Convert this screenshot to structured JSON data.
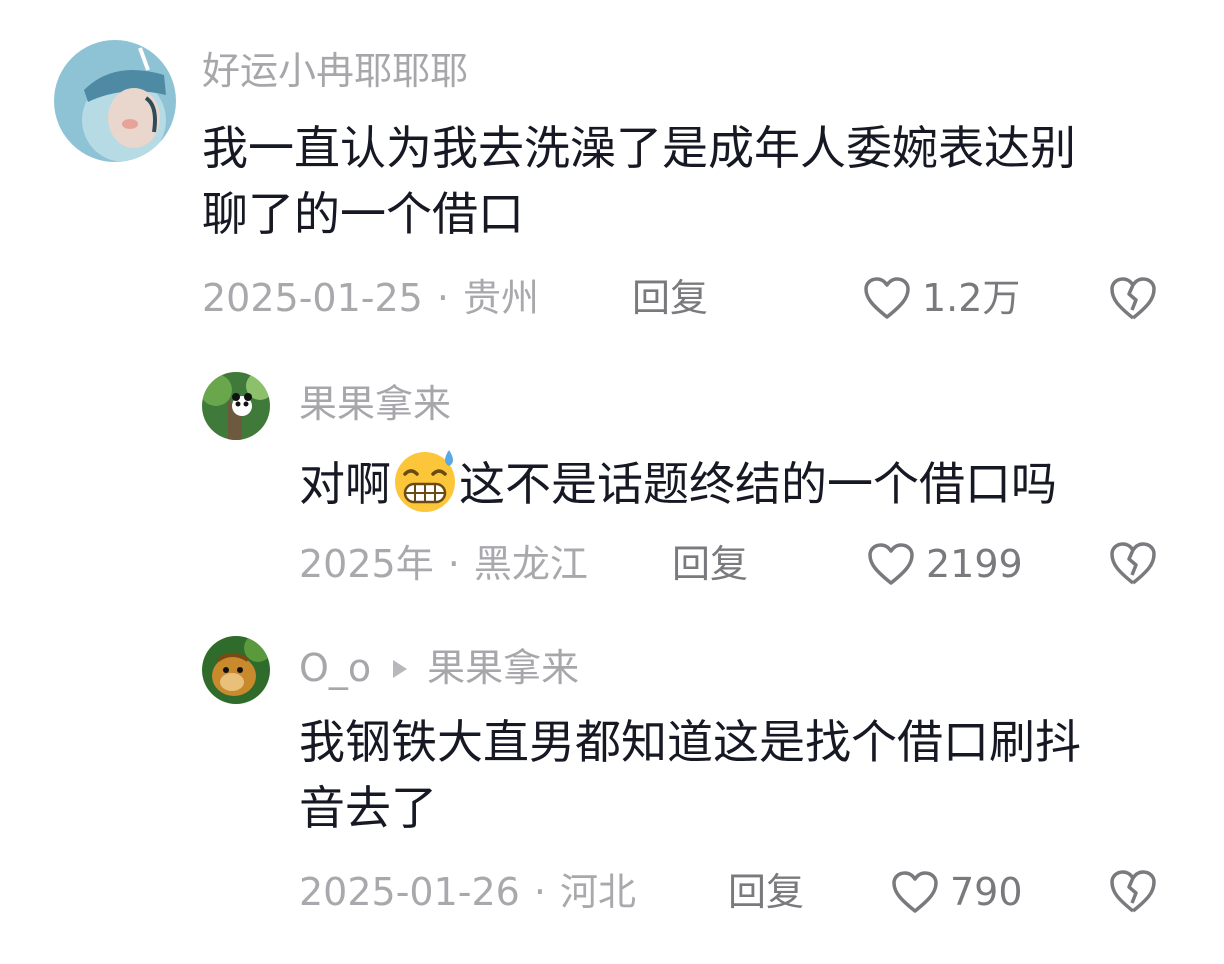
{
  "comments": [
    {
      "user": "好运小冉耶耶耶",
      "lines": [
        "我一直认为我去洗澡了是成年人委婉表达别",
        "聊了的一个借口"
      ],
      "date": "2025-01-25",
      "location": "贵州",
      "reply_label": "回复",
      "likes": "1.2万",
      "like_icon": "heart-outline-icon",
      "dislike_icon": "broken-heart-icon"
    },
    {
      "user": "果果拿来",
      "text_before": "对啊",
      "emoji": "grimacing-sweat-emoji",
      "text_after": "这不是话题终结的一个借口吗",
      "date": "2025年",
      "location": "黑龙江",
      "reply_label": "回复",
      "likes": "2199"
    },
    {
      "user": "O_o",
      "reply_to": "果果拿来",
      "lines": [
        "我钢铁大直男都知道这是找个借口刷抖",
        "音去了"
      ],
      "date": "2025-01-26",
      "location": "河北",
      "reply_label": "回复",
      "likes": "790"
    }
  ],
  "separator": "·",
  "colors": {
    "text": "#161823",
    "meta": "#a9a9ad",
    "action": "#7a7a7e"
  }
}
